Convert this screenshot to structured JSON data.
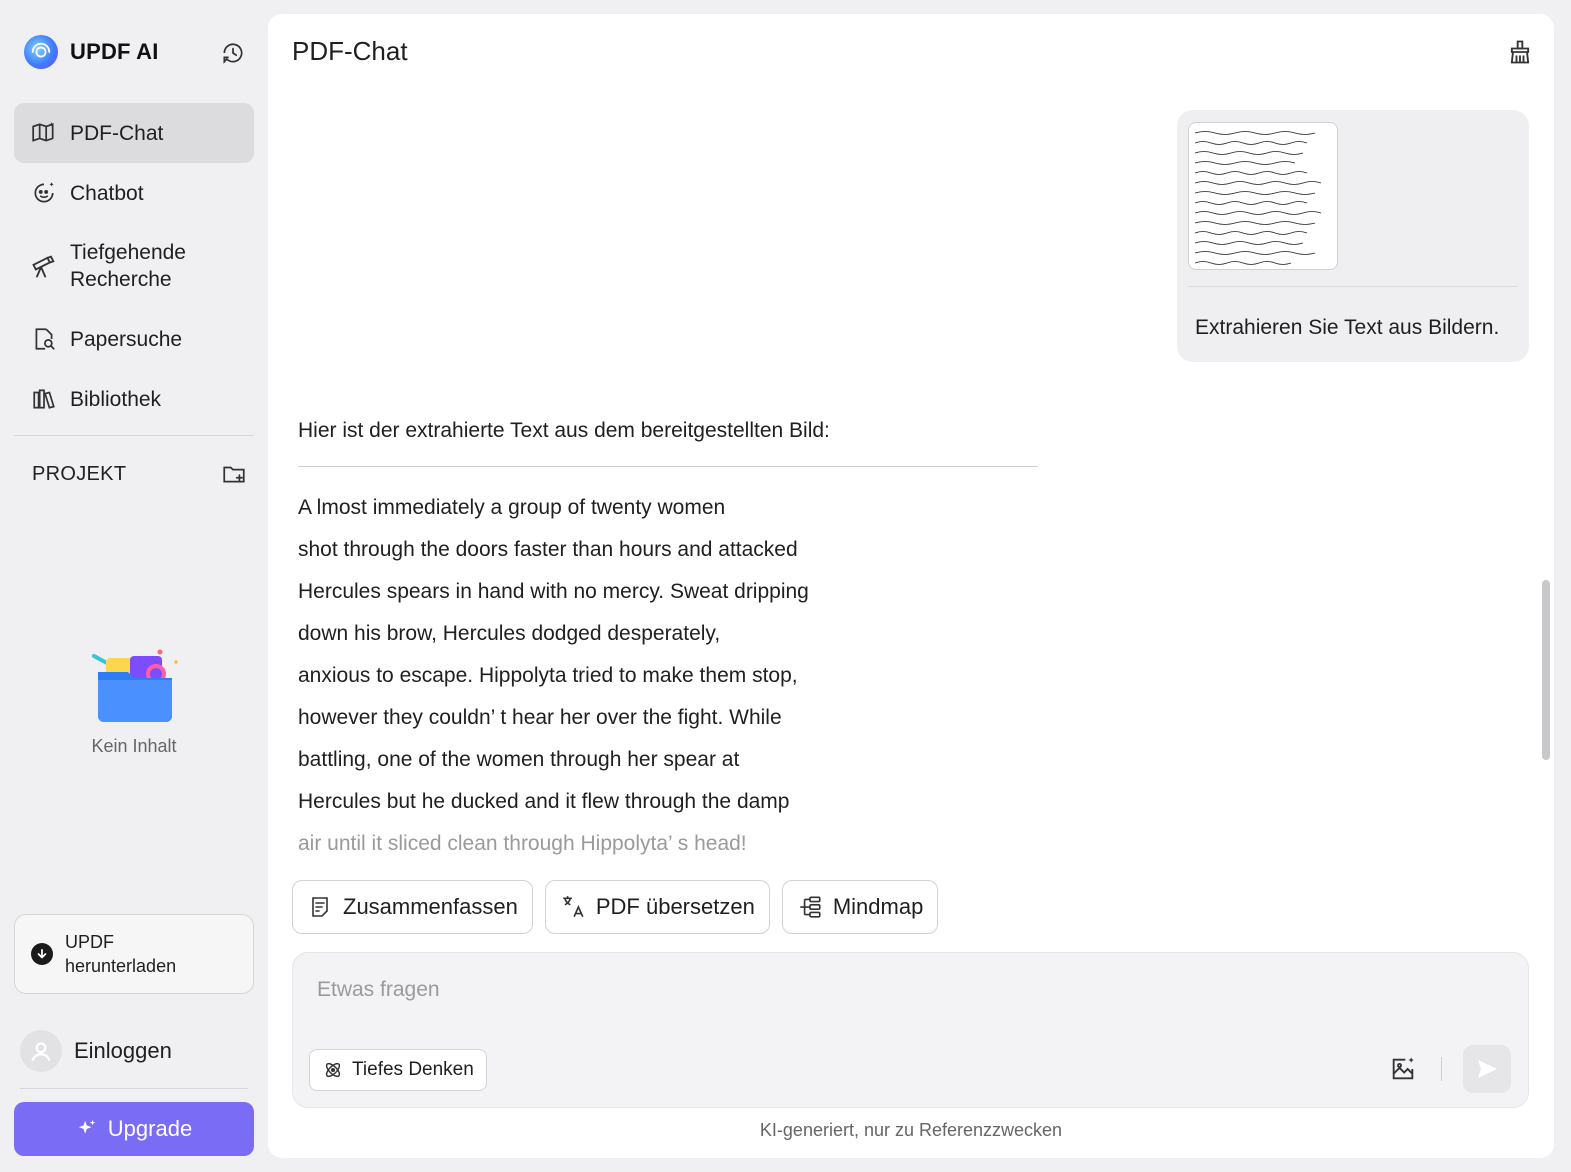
{
  "brand": {
    "name": "UPDF AI"
  },
  "sidebar": {
    "items": [
      {
        "label": "PDF-Chat",
        "icon": "book-sparkle-icon",
        "active": true
      },
      {
        "label": "Chatbot",
        "icon": "bot-face-icon"
      },
      {
        "label": "Tiefgehende Recherche",
        "icon": "telescope-icon"
      },
      {
        "label": "Papersuche",
        "icon": "paper-search-icon"
      },
      {
        "label": "Bibliothek",
        "icon": "library-icon"
      }
    ],
    "project_label": "PROJEKT",
    "empty_text": "Kein Inhalt",
    "download_label": "UPDF herunterladen",
    "login_label": "Einloggen",
    "upgrade_label": "Upgrade"
  },
  "main": {
    "title": "PDF-Chat",
    "user_message": "Extrahieren Sie Text aus Bildern.",
    "answer_intro": "Hier ist der extrahierte Text aus dem bereitgestellten Bild:",
    "answer_lines": [
      "A lmost immediately a group of twenty women",
      "shot through the doors faster than hours and attacked",
      "Hercules spears in hand with no mercy. Sweat dripping",
      "down his brow, Hercules dodged desperately,",
      "anxious to escape. Hippolyta tried to make them stop,",
      "however they couldn’ t hear her over the fight. While",
      "battling, one of the women through her spear at",
      "Hercules but he ducked and it flew through the damp",
      "air until it sliced clean through Hippolyta’ s head!"
    ],
    "quick_actions": [
      {
        "label": "Zusammenfassen",
        "icon": "summary-icon"
      },
      {
        "label": "PDF übersetzen",
        "icon": "translate-icon"
      },
      {
        "label": "Mindmap",
        "icon": "mindmap-icon"
      }
    ],
    "composer": {
      "placeholder": "Etwas fragen",
      "deep_thinking_label": "Tiefes Denken"
    },
    "footer_note": "KI-generiert, nur zu Referenzzwecken"
  },
  "colors": {
    "accent": "#7a6cf5",
    "active_nav": "#dcdcde"
  }
}
